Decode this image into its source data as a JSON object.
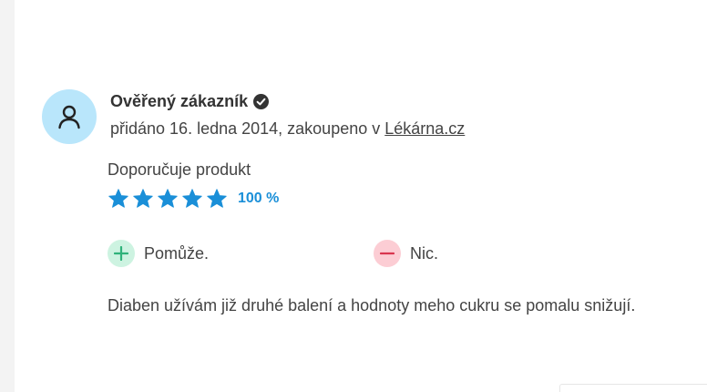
{
  "review": {
    "author": "Ověřený zákazník",
    "meta_prefix": "přidáno 16. ledna 2014, zakoupeno v ",
    "store_link": "Lékárna.cz",
    "recommend_label": "Doporučuje produkt",
    "rating_stars": 5,
    "rating_max": 5,
    "rating_percent": "100 %",
    "pros": "Pomůže.",
    "cons": "Nic.",
    "text": "Diaben užívám již druhé balení a hodnoty meho cukru se pomalu snižují."
  },
  "colors": {
    "avatar_bg": "#b9e6fb",
    "star": "#1a8fd8",
    "plus_bg": "#cdf3e1",
    "plus_icon": "#2fb27a",
    "minus_bg": "#fccdd4",
    "minus_icon": "#d9364f"
  },
  "icons": {
    "avatar": "user-icon",
    "verified": "verified-check-icon",
    "star": "star-icon",
    "pros": "plus-icon",
    "cons": "minus-icon"
  }
}
